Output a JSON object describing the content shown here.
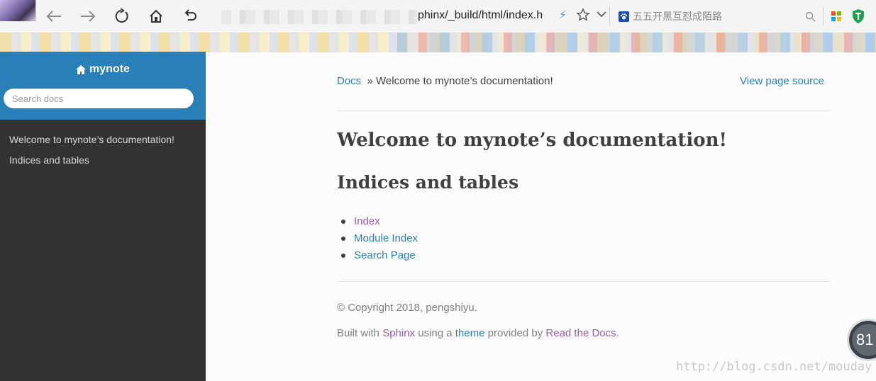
{
  "browser": {
    "url_visible": "phinx/_build/html/index.h",
    "search_placeholder": "五五开黑互怼成陌路"
  },
  "sidebar": {
    "brand": "mynote",
    "search_placeholder": "Search docs",
    "items": [
      {
        "label": "Welcome to mynote’s documentation!"
      },
      {
        "label": "Indices and tables"
      }
    ]
  },
  "breadcrumbs": {
    "root": "Docs",
    "separator": "»",
    "current": "Welcome to mynote’s documentation!",
    "view_source": "View page source"
  },
  "content": {
    "h1": "Welcome to mynote’s documentation!",
    "h2": "Indices and tables",
    "links": [
      {
        "label": "Index",
        "visited": true
      },
      {
        "label": "Module Index",
        "visited": false
      },
      {
        "label": "Search Page",
        "visited": false
      }
    ]
  },
  "footer": {
    "copyright": "© Copyright 2018, pengshiyu.",
    "built_prefix": "Built with",
    "sphinx": "Sphinx",
    "using_a": "using a",
    "theme": "theme",
    "provided_by": "provided by",
    "rtd": "Read the Docs",
    "period": "."
  },
  "overlay": {
    "badge_value": "81",
    "watermark": "http://blog.csdn.net/mouday"
  },
  "colors": {
    "accent": "#2980b9",
    "visited": "#9b59b6",
    "sidebar_bg": "#343131",
    "text": "#404040"
  }
}
